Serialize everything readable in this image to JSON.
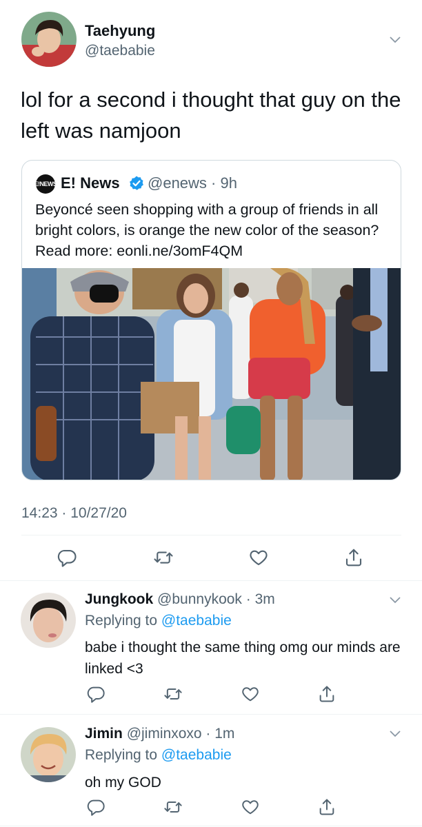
{
  "main_tweet": {
    "display_name": "Taehyung",
    "handle": "@taebabie",
    "text": "lol for a second i thought that guy on the left was namjoon",
    "timestamp": "14:23 · 10/27/20"
  },
  "quoted_tweet": {
    "logo_text": "E!NEWS",
    "display_name": "E! News",
    "handle_time": "@enews · 9h",
    "text": "Beyoncé seen shopping with a group of friends in all bright colors, is orange the new color of the season? Read more: eonli.ne/3omF4QM"
  },
  "replies": [
    {
      "display_name": "Jungkook",
      "handle_time": "@bunnykook · 3m",
      "replying_prefix": "Replying to ",
      "replying_to": "@taebabie",
      "text": "babe i thought the same thing omg our minds are linked <3"
    },
    {
      "display_name": "Jimin",
      "handle_time": "@jiminxoxo · 1m",
      "replying_prefix": "Replying to ",
      "replying_to": "@taebabie",
      "text": "oh my GOD"
    }
  ],
  "icons": [
    "reply-icon",
    "retweet-icon",
    "like-icon",
    "share-icon",
    "chevron-down-icon",
    "verified-badge-icon"
  ],
  "colors": {
    "accent": "#1d9bf0",
    "text": "#0f1419",
    "secondary": "#536471",
    "border": "#cfd9de"
  }
}
